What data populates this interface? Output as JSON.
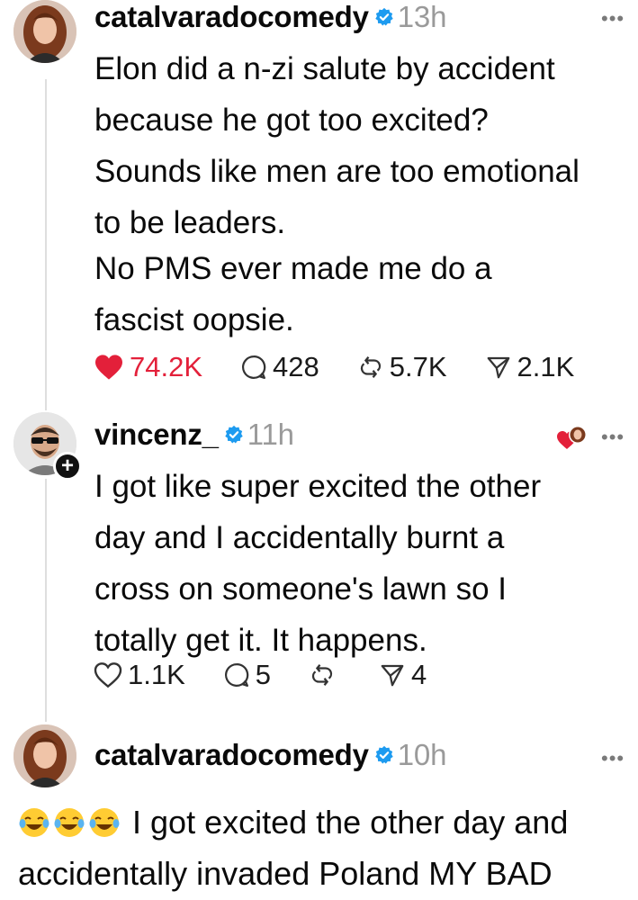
{
  "colors": {
    "like_red": "#e3203a",
    "verified_blue": "#1d9bf0",
    "muted": "#9a9a9a"
  },
  "posts": [
    {
      "avatar_icon": "woman-avatar",
      "username": "catalvaradocomedy",
      "time": "13h",
      "lines": [
        "Elon did a n-zi salute by accident",
        "because he got too excited?",
        "Sounds like men are too emotional",
        "to be leaders."
      ],
      "lines2": [
        "No PMS ever made me do a",
        "fascist oopsie."
      ],
      "likes": "74.2K",
      "comments": "428",
      "reposts": "5.7K",
      "shares": "2.1K"
    },
    {
      "avatar_icon": "man-sunglasses-avatar",
      "username": "vincenz_",
      "time": "11h",
      "lines": [
        "I got like super excited the other",
        "day and I accidentally burnt a",
        "cross on someone's lawn so I",
        "totally get it. It happens."
      ],
      "likes": "1.1K",
      "comments": "5",
      "shares": "4"
    },
    {
      "avatar_icon": "woman-avatar",
      "username": "catalvaradocomedy",
      "time": "10h",
      "line1": "I got excited the other day and",
      "line2": "accidentally invaded Poland MY BAD"
    }
  ]
}
